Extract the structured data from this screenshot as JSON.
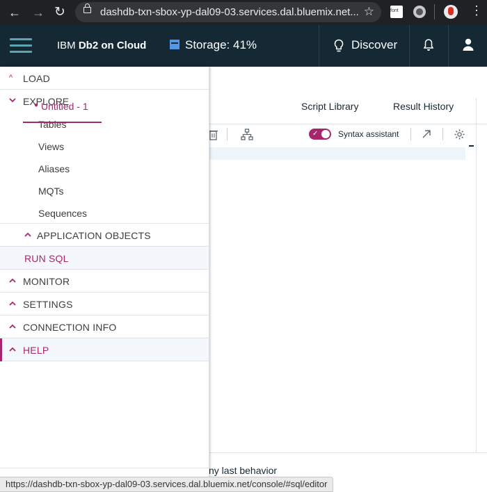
{
  "browser": {
    "url": "dashdb-txn-sbox-yp-dal09-03.services.dal.bluemix.net...",
    "extension_label": "font"
  },
  "header": {
    "brand_prefix": "IBM",
    "brand_name": "Db2 on Cloud",
    "storage_label": "Storage: 41%",
    "storage_percent": 41,
    "discover_label": "Discover"
  },
  "main": {
    "tabs": [
      "Script Library",
      "Result History"
    ],
    "syntax_assistant_label": "Syntax assistant",
    "syntax_assistant_on": true,
    "footer_text": "ny last behavior"
  },
  "sidebar": {
    "sections": [
      {
        "label": "LOAD",
        "icon": "chevron-up-icon"
      },
      {
        "label": "EXPLORE",
        "icon": "chevron-down-icon",
        "expanded": true
      }
    ],
    "explore_items": [
      "Tables",
      "Views",
      "Aliases",
      "MQTs",
      "Sequences"
    ],
    "app_objects_label": "APPLICATION OBJECTS",
    "run_sql_label": "RUN SQL",
    "more_sections": [
      "MONITOR",
      "SETTINGS",
      "CONNECTION INFO",
      "HELP"
    ],
    "overlap_tab_label": "Untitled - 1"
  },
  "status_url": "https://dashdb-txn-sbox-yp-dal09-03.services.dal.bluemix.net/console/#sql/editor",
  "colors": {
    "header_bg": "#152935",
    "accent": "#a6266e",
    "hamburger": "#5aa7b0",
    "storage_icon": "#5596e6"
  }
}
